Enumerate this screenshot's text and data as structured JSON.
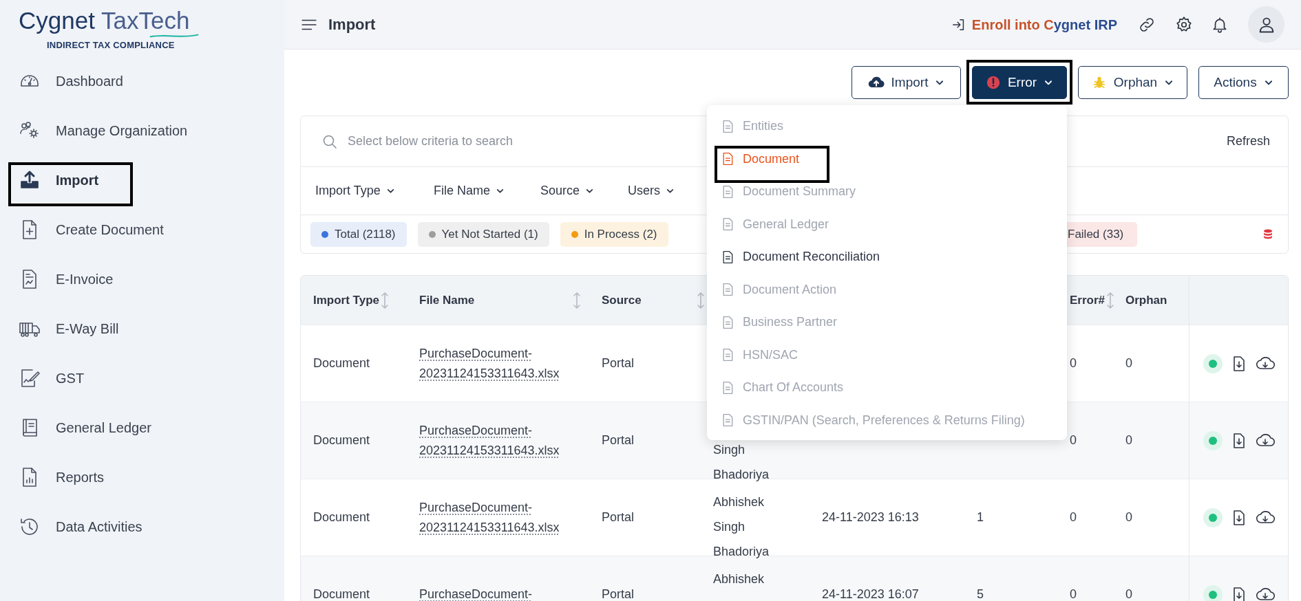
{
  "logo": {
    "title_main": "Cygnet",
    "title_rest": "TaxTech",
    "tagline": "INDIRECT TAX COMPLIANCE"
  },
  "sidebar": {
    "items": [
      {
        "label": "Dashboard",
        "selected": false,
        "highlighted": false
      },
      {
        "label": "Manage Organization",
        "selected": false,
        "highlighted": false
      },
      {
        "label": "Import",
        "selected": true,
        "highlighted": true
      },
      {
        "label": "Create Document",
        "selected": false,
        "highlighted": false
      },
      {
        "label": "E-Invoice",
        "selected": false,
        "highlighted": false
      },
      {
        "label": "E-Way Bill",
        "selected": false,
        "highlighted": false
      },
      {
        "label": "GST",
        "selected": false,
        "highlighted": false
      },
      {
        "label": "General Ledger",
        "selected": false,
        "highlighted": false
      },
      {
        "label": "Reports",
        "selected": false,
        "highlighted": false
      },
      {
        "label": "Data Activities",
        "selected": false,
        "highlighted": false
      }
    ]
  },
  "header": {
    "title": "Import",
    "enroll_link": [
      {
        "text": "Enroll into C",
        "kind": "accent"
      },
      {
        "text": "ygnet IRP",
        "kind": "brand"
      }
    ]
  },
  "toolbar": {
    "buttons": [
      {
        "label": "Import",
        "kind": "outline",
        "highlighted": false
      },
      {
        "label": "Error",
        "kind": "filled",
        "highlighted": true,
        "expanded": true
      },
      {
        "label": "Orphan",
        "kind": "outline",
        "highlighted": false
      },
      {
        "label": "Actions",
        "kind": "outline",
        "highlighted": false
      }
    ]
  },
  "error_menu": [
    {
      "label": "Entities",
      "disabled": true,
      "selected": false,
      "highlighted": false
    },
    {
      "label": "Document",
      "disabled": false,
      "selected": true,
      "highlighted": true
    },
    {
      "label": "Document Summary",
      "disabled": true,
      "selected": false,
      "highlighted": false
    },
    {
      "label": "General Ledger",
      "disabled": true,
      "selected": false,
      "highlighted": false
    },
    {
      "label": "Document Reconciliation",
      "disabled": false,
      "selected": false,
      "highlighted": false
    },
    {
      "label": "Document Action",
      "disabled": true,
      "selected": false,
      "highlighted": false
    },
    {
      "label": "Business Partner",
      "disabled": true,
      "selected": false,
      "highlighted": false
    },
    {
      "label": "HSN/SAC",
      "disabled": true,
      "selected": false,
      "highlighted": false
    },
    {
      "label": "Chart Of Accounts",
      "disabled": true,
      "selected": false,
      "highlighted": false
    },
    {
      "label": "GSTIN/PAN (Search, Preferences & Returns Filing)",
      "disabled": true,
      "selected": false,
      "highlighted": false
    }
  ],
  "search": {
    "placeholder": "Select below criteria to search",
    "refresh": "Refresh"
  },
  "filters": [
    "Import Type",
    "File Name",
    "Source",
    "Users"
  ],
  "status_chips": [
    {
      "label": "Total (2118)",
      "color": "#3b74e0"
    },
    {
      "label": "Yet Not Started (1)",
      "color": "#9e9e9e"
    },
    {
      "label": "In Process (2)",
      "color": "#f29a12"
    },
    {
      "label": "Failed (33)"
    }
  ],
  "table": {
    "columns": [
      {
        "label": "Import Type",
        "sortable": true
      },
      {
        "label": "File Name",
        "sortable": true
      },
      {
        "label": "Source",
        "sortable": true
      },
      {
        "label": "Error#",
        "sortable": true
      },
      {
        "label": "Orphan",
        "sortable": false
      }
    ],
    "rows": [
      {
        "import_type": "Document",
        "file_name": "PurchaseDocument-20231124153311643.xlsx",
        "source": "Portal",
        "error": "0",
        "orphan": "0"
      },
      {
        "import_type": "Document",
        "file_name": "PurchaseDocument-20231124153311643.xlsx",
        "source": "Portal",
        "user": [
          "Singh",
          "Bhadoriya"
        ],
        "user_covered": true,
        "error": "0",
        "orphan": "0"
      },
      {
        "import_type": "Document",
        "file_name": "PurchaseDocument-20231124153311643.xlsx",
        "source": "Portal",
        "user": [
          "Abhishek",
          "Singh",
          "Bhadoriya"
        ],
        "user_covered": false,
        "date": "24-11-2023 16:13",
        "count": "1",
        "error": "0",
        "orphan": "0"
      },
      {
        "import_type": "Document",
        "file_name": "PurchaseDocument-",
        "source": "Portal",
        "user": [
          "Abhishek"
        ],
        "user_covered": false,
        "date": "24-11-2023 16:07",
        "count": "5",
        "error": "0",
        "orphan": "0"
      }
    ]
  }
}
